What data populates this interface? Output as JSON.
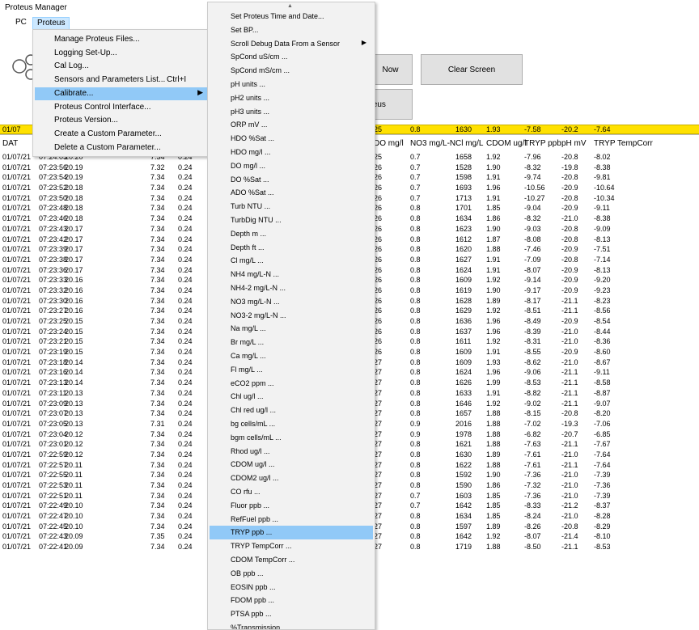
{
  "window": {
    "title": "Proteus Manager"
  },
  "menubar": {
    "items": [
      "PC",
      "Proteus"
    ]
  },
  "buttons": {
    "now": "Now",
    "clear_screen": "Clear Screen",
    "proteus": "teus"
  },
  "latest": {
    "date": "01/07",
    "values": [
      "25",
      "0.8",
      "1630",
      "1.93",
      "-7.58",
      "-20.2",
      "-7.64"
    ]
  },
  "grid": {
    "headers": [
      "DAT",
      "DO mg/l",
      "NO3 mg/L-N",
      "Cl mg/L",
      "CDOM ug/l",
      "TRYP ppb",
      "pH mV",
      "TRYP TempCorr"
    ],
    "rows": [
      [
        "01/07/21",
        "07:24:03",
        "20.20",
        "7.34",
        "0.24",
        "25",
        "0.7",
        "1658",
        "1.92",
        "-7.96",
        "-20.8",
        "-8.02"
      ],
      [
        "01/07/21",
        "07:23:56",
        "20.19",
        "7.32",
        "0.24",
        "26",
        "0.7",
        "1528",
        "1.90",
        "-8.32",
        "-19.8",
        "-8.38"
      ],
      [
        "01/07/21",
        "07:23:54",
        "20.19",
        "7.34",
        "0.24",
        "26",
        "0.7",
        "1598",
        "1.91",
        "-9.74",
        "-20.8",
        "-9.81"
      ],
      [
        "01/07/21",
        "07:23:52",
        "20.18",
        "7.34",
        "0.24",
        "26",
        "0.7",
        "1693",
        "1.96",
        "-10.56",
        "-20.9",
        "-10.64"
      ],
      [
        "01/07/21",
        "07:23:50",
        "20.18",
        "7.34",
        "0.24",
        "26",
        "0.7",
        "1713",
        "1.91",
        "-10.27",
        "-20.8",
        "-10.34"
      ],
      [
        "01/07/21",
        "07:23:48",
        "20.18",
        "7.34",
        "0.24",
        "26",
        "0.8",
        "1701",
        "1.85",
        "-9.04",
        "-20.9",
        "-9.11"
      ],
      [
        "01/07/21",
        "07:23:46",
        "20.18",
        "7.34",
        "0.24",
        "26",
        "0.8",
        "1634",
        "1.86",
        "-8.32",
        "-21.0",
        "-8.38"
      ],
      [
        "01/07/21",
        "07:23:43",
        "20.17",
        "7.34",
        "0.24",
        "26",
        "0.8",
        "1623",
        "1.90",
        "-9.03",
        "-20.8",
        "-9.09"
      ],
      [
        "01/07/21",
        "07:23:42",
        "20.17",
        "7.34",
        "0.24",
        "26",
        "0.8",
        "1612",
        "1.87",
        "-8.08",
        "-20.8",
        "-8.13"
      ],
      [
        "01/07/21",
        "07:23:39",
        "20.17",
        "7.34",
        "0.24",
        "26",
        "0.8",
        "1620",
        "1.88",
        "-7.46",
        "-20.9",
        "-7.51"
      ],
      [
        "01/07/21",
        "07:23:38",
        "20.17",
        "7.34",
        "0.24",
        "26",
        "0.8",
        "1627",
        "1.91",
        "-7.09",
        "-20.8",
        "-7.14"
      ],
      [
        "01/07/21",
        "07:23:36",
        "20.17",
        "7.34",
        "0.24",
        "26",
        "0.8",
        "1624",
        "1.91",
        "-8.07",
        "-20.9",
        "-8.13"
      ],
      [
        "01/07/21",
        "07:23:33",
        "20.16",
        "7.34",
        "0.24",
        "26",
        "0.8",
        "1609",
        "1.92",
        "-9.14",
        "-20.9",
        "-9.20"
      ],
      [
        "01/07/21",
        "07:23:32",
        "20.16",
        "7.34",
        "0.24",
        "26",
        "0.8",
        "1619",
        "1.90",
        "-9.17",
        "-20.9",
        "-9.23"
      ],
      [
        "01/07/21",
        "07:23:30",
        "20.16",
        "7.34",
        "0.24",
        "26",
        "0.8",
        "1628",
        "1.89",
        "-8.17",
        "-21.1",
        "-8.23"
      ],
      [
        "01/07/21",
        "07:23:27",
        "20.16",
        "7.34",
        "0.24",
        "26",
        "0.8",
        "1629",
        "1.92",
        "-8.51",
        "-21.1",
        "-8.56"
      ],
      [
        "01/07/21",
        "07:23:25",
        "20.15",
        "7.34",
        "0.24",
        "26",
        "0.8",
        "1636",
        "1.96",
        "-8.49",
        "-20.9",
        "-8.54"
      ],
      [
        "01/07/21",
        "07:23:24",
        "20.15",
        "7.34",
        "0.24",
        "26",
        "0.8",
        "1637",
        "1.96",
        "-8.39",
        "-21.0",
        "-8.44"
      ],
      [
        "01/07/21",
        "07:23:21",
        "20.15",
        "7.34",
        "0.24",
        "26",
        "0.8",
        "1611",
        "1.92",
        "-8.31",
        "-21.0",
        "-8.36"
      ],
      [
        "01/07/21",
        "07:23:19",
        "20.15",
        "7.34",
        "0.24",
        "26",
        "0.8",
        "1609",
        "1.91",
        "-8.55",
        "-20.9",
        "-8.60"
      ],
      [
        "01/07/21",
        "07:23:18",
        "20.14",
        "7.34",
        "0.24",
        "27",
        "0.8",
        "1609",
        "1.93",
        "-8.62",
        "-21.0",
        "-8.67"
      ],
      [
        "01/07/21",
        "07:23:16",
        "20.14",
        "7.34",
        "0.24",
        "27",
        "0.8",
        "1624",
        "1.96",
        "-9.06",
        "-21.1",
        "-9.11"
      ],
      [
        "01/07/21",
        "07:23:13",
        "20.14",
        "7.34",
        "0.24",
        "27",
        "0.8",
        "1626",
        "1.99",
        "-8.53",
        "-21.1",
        "-8.58"
      ],
      [
        "01/07/21",
        "07:23:11",
        "20.13",
        "7.34",
        "0.24",
        "27",
        "0.8",
        "1633",
        "1.91",
        "-8.82",
        "-21.1",
        "-8.87"
      ],
      [
        "01/07/21",
        "07:23:09",
        "20.13",
        "7.34",
        "0.24",
        "27",
        "0.8",
        "1646",
        "1.92",
        "-9.02",
        "-21.1",
        "-9.07"
      ],
      [
        "01/07/21",
        "07:23:07",
        "20.13",
        "7.34",
        "0.24",
        "27",
        "0.8",
        "1657",
        "1.88",
        "-8.15",
        "-20.8",
        "-8.20"
      ],
      [
        "01/07/21",
        "07:23:05",
        "20.13",
        "7.31",
        "0.24",
        "27",
        "0.9",
        "2016",
        "1.88",
        "-7.02",
        "-19.3",
        "-7.06"
      ],
      [
        "01/07/21",
        "07:23:04",
        "20.12",
        "7.34",
        "0.24",
        "27",
        "0.9",
        "1978",
        "1.88",
        "-6.82",
        "-20.7",
        "-6.85"
      ],
      [
        "01/07/21",
        "07:23:01",
        "20.12",
        "7.34",
        "0.24",
        "27",
        "0.8",
        "1621",
        "1.88",
        "-7.63",
        "-21.1",
        "-7.67"
      ],
      [
        "01/07/21",
        "07:22:59",
        "20.12",
        "7.34",
        "0.24",
        "27",
        "0.8",
        "1630",
        "1.89",
        "-7.61",
        "-21.0",
        "-7.64"
      ],
      [
        "01/07/21",
        "07:22:57",
        "20.11",
        "7.34",
        "0.24",
        "27",
        "0.8",
        "1622",
        "1.88",
        "-7.61",
        "-21.1",
        "-7.64"
      ],
      [
        "01/07/21",
        "07:22:55",
        "20.11",
        "7.34",
        "0.24",
        "27",
        "0.8",
        "1592",
        "1.90",
        "-7.36",
        "-21.0",
        "-7.39"
      ],
      [
        "01/07/21",
        "07:22:53",
        "20.11",
        "7.34",
        "0.24",
        "27",
        "0.8",
        "1590",
        "1.86",
        "-7.32",
        "-21.0",
        "-7.36"
      ],
      [
        "01/07/21",
        "07:22:51",
        "20.11",
        "7.34",
        "0.24",
        "27",
        "0.7",
        "1603",
        "1.85",
        "-7.36",
        "-21.0",
        "-7.39"
      ],
      [
        "01/07/21",
        "07:22:49",
        "20.10",
        "7.34",
        "0.24",
        "27",
        "0.7",
        "1642",
        "1.85",
        "-8.33",
        "-21.2",
        "-8.37"
      ],
      [
        "01/07/21",
        "07:22:47",
        "20.10",
        "7.34",
        "0.24",
        "27",
        "0.8",
        "1634",
        "1.85",
        "-8.24",
        "-21.0",
        "-8.28"
      ],
      [
        "01/07/21",
        "07:22:45",
        "20.10",
        "7.34",
        "0.24",
        "27",
        "0.8",
        "1597",
        "1.89",
        "-8.26",
        "-20.8",
        "-8.29"
      ],
      [
        "01/07/21",
        "07:22:43",
        "20.09",
        "7.35",
        "0.24",
        "27",
        "0.8",
        "1642",
        "1.92",
        "-8.07",
        "-21.4",
        "-8.10"
      ],
      [
        "01/07/21",
        "07:22:41",
        "20.09",
        "7.34",
        "0.24",
        "27",
        "0.8",
        "1719",
        "1.88",
        "-8.50",
        "-21.1",
        "-8.53"
      ]
    ]
  },
  "proteus_menu": {
    "items": [
      {
        "label": "Manage Proteus Files...",
        "shortcut": "",
        "arrow": false
      },
      {
        "label": "Logging Set-Up...",
        "shortcut": "",
        "arrow": false
      },
      {
        "label": "Cal Log...",
        "shortcut": "",
        "arrow": false
      },
      {
        "label": "Sensors and Parameters List...",
        "shortcut": "Ctrl+I",
        "arrow": false
      },
      {
        "label": "Calibrate...",
        "shortcut": "",
        "arrow": true
      },
      {
        "label": "Proteus Control Interface...",
        "shortcut": "",
        "arrow": false
      },
      {
        "label": "Proteus Version...",
        "shortcut": "",
        "arrow": false
      },
      {
        "label": "Create a Custom Parameter...",
        "shortcut": "",
        "arrow": false
      },
      {
        "label": "Delete a Custom Parameter...",
        "shortcut": "",
        "arrow": false
      }
    ],
    "highlighted_index": 4
  },
  "calibrate_menu": {
    "items": [
      "Set Proteus Time and Date...",
      "Set BP...",
      "Scroll Debug Data From a Sensor",
      "SpCond uS/cm ...",
      "SpCond mS/cm ...",
      "pH units ...",
      "pH2 units ...",
      "pH3 units ...",
      "ORP mV ...",
      "HDO %Sat ...",
      "HDO mg/l ...",
      "DO mg/l ...",
      "DO %Sat ...",
      "ADO %Sat ...",
      "Turb NTU ...",
      "TurbDig NTU ...",
      "Depth m ...",
      "Depth ft ...",
      "Cl mg/L ...",
      "NH4 mg/L-N ...",
      "NH4-2 mg/L-N ...",
      "NO3 mg/L-N ...",
      "NO3-2 mg/L-N ...",
      "Na mg/L ...",
      "Br mg/L ...",
      "Ca mg/L ...",
      "Fl mg/L ...",
      "eCO2 ppm ...",
      "Chl ug/l ...",
      "Chl red ug/l ...",
      "bg cells/mL ...",
      "bgm cells/mL ...",
      "Rhod ug/l ...",
      "CDOM ug/l ...",
      "CDOM2 ug/l ...",
      "CO rfu ...",
      "Fluor ppb ...",
      "RefFuel ppb ...",
      "TRYP ppb ...",
      "TRYP TempCorr ...",
      "CDOM TempCorr ...",
      "OB ppb ...",
      "EOSIN ppb ...",
      "FDOM ppb ...",
      "PTSA ppb ...",
      "%Transmission ..."
    ],
    "submenu_index": 2,
    "highlighted_index": 38
  }
}
